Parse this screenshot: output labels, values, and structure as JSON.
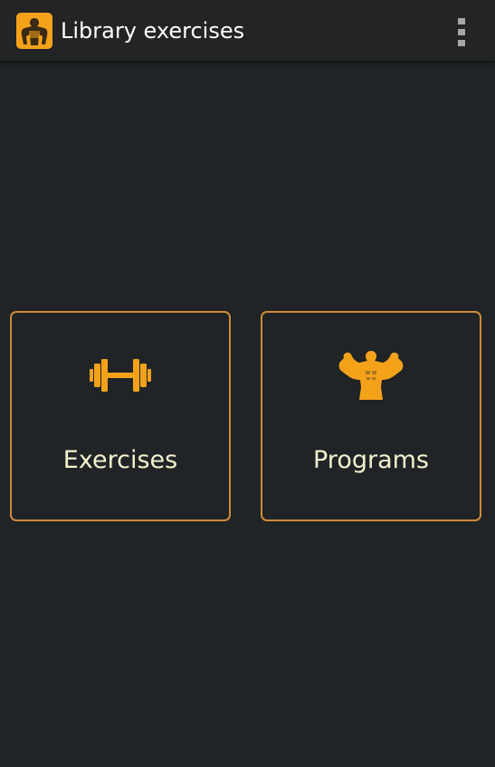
{
  "app_bar": {
    "icon": "bodybuilder-app-icon",
    "title": "Library exercises",
    "menu_icon": "overflow-menu-icon"
  },
  "tiles": [
    {
      "label": "Exercises",
      "icon": "dumbbell-icon"
    },
    {
      "label": "Programs",
      "icon": "flexing-bodybuilder-icon"
    }
  ],
  "colors": {
    "background": "#202426",
    "accent": "#f5a21b",
    "tile_border": "#d08a3a",
    "label_text": "#f4f1cf",
    "title_text": "#ffffff"
  }
}
